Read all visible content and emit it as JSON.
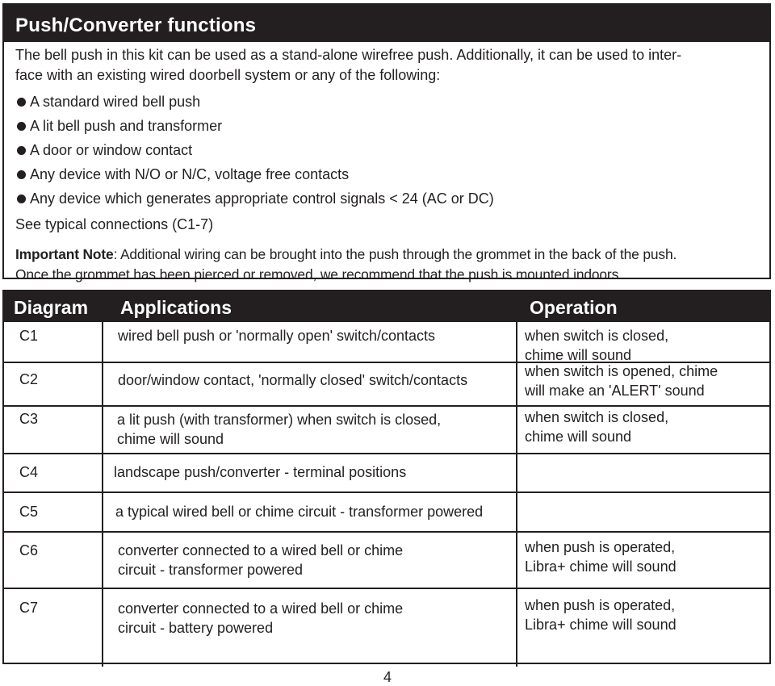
{
  "section": {
    "title": "Push/Converter functions",
    "intro_line1": "The bell push in this kit can be used as a stand-alone wirefree push. Additionally, it can be used to inter-",
    "intro_line2": "face with an existing wired doorbell system or any of the following:",
    "bullets": [
      "A standard wired bell push",
      "A lit bell push and transformer",
      "A door or window contact",
      "Any device with N/O or N/C, voltage free contacts",
      "Any device which generates appropriate control signals < 24 (AC or DC)"
    ],
    "see_connections": "See typical connections (C1-7)",
    "note_label": "Important Note",
    "note_text": ": Additional wiring can be brought into the push through the grommet in the back of the push.",
    "note_line2": "Once the grommet has been pierced or removed, we recommend that the push is mounted indoors."
  },
  "table": {
    "headers": {
      "diagram": "Diagram",
      "applications": "Applications",
      "operation": "Operation"
    },
    "rows": [
      {
        "diagram": "C1",
        "application": "wired bell push or 'normally open' switch/contacts",
        "operation": "when switch is closed,\nchime will sound"
      },
      {
        "diagram": "C2",
        "application": "door/window contact, 'normally closed' switch/contacts",
        "operation": "when switch is opened, chime\nwill make an 'ALERT' sound"
      },
      {
        "diagram": "C3",
        "application": "a lit push (with transformer) when switch is closed,\n chime will sound",
        "operation": "when switch is closed,\nchime will sound"
      },
      {
        "diagram": "C4",
        "application": "landscape push/converter -  terminal positions",
        "operation": ""
      },
      {
        "diagram": "C5",
        "application": "a typical wired bell or chime circuit - transformer powered",
        "operation": ""
      },
      {
        "diagram": "C6",
        "application": "converter connected to a wired bell or chime\n circuit - transformer powered",
        "operation": "when push is operated,\nLibra+ chime will sound"
      },
      {
        "diagram": "C7",
        "application": "converter connected to a wired bell or chime\ncircuit - battery powered",
        "operation": "when push is operated,\nLibra+ chime will sound"
      }
    ]
  },
  "page_number": "4"
}
